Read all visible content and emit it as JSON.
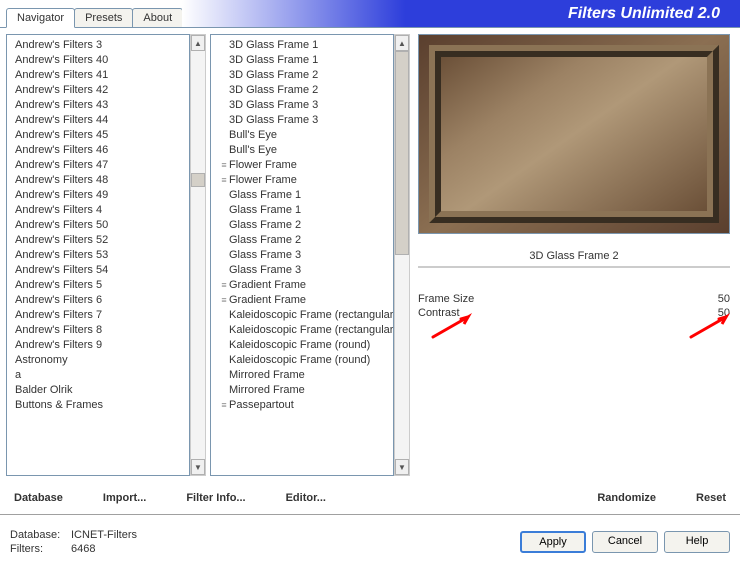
{
  "header": {
    "tabs": [
      {
        "label": "Navigator",
        "active": true
      },
      {
        "label": "Presets",
        "active": false
      },
      {
        "label": "About",
        "active": false
      }
    ],
    "banner_title": "Filters Unlimited 2.0"
  },
  "list_left": [
    "Andrew's Filters 3",
    "Andrew's Filters 40",
    "Andrew's Filters 41",
    "Andrew's Filters 42",
    "Andrew's Filters 43",
    "Andrew's Filters 44",
    "Andrew's Filters 45",
    "Andrew's Filters 46",
    "Andrew's Filters 47",
    "Andrew's Filters 48",
    "Andrew's Filters 49",
    "Andrew's Filters 4",
    "Andrew's Filters 50",
    "Andrew's Filters 52",
    "Andrew's Filters 53",
    "Andrew's Filters 54",
    "Andrew's Filters 5",
    "Andrew's Filters 6",
    "Andrew's Filters 7",
    "Andrew's Filters 8",
    "Andrew's Filters 9",
    "Astronomy",
    "a",
    "Balder Olrik",
    "Buttons & Frames"
  ],
  "list_right": [
    {
      "label": "3D Glass Frame 1",
      "decor": ""
    },
    {
      "label": "3D Glass Frame 1",
      "decor": ""
    },
    {
      "label": "3D Glass Frame 2",
      "decor": ""
    },
    {
      "label": "3D Glass Frame 2",
      "decor": ""
    },
    {
      "label": "3D Glass Frame 3",
      "decor": ""
    },
    {
      "label": "3D Glass Frame 3",
      "decor": ""
    },
    {
      "label": "Bull's Eye",
      "decor": ""
    },
    {
      "label": "Bull's Eye",
      "decor": ""
    },
    {
      "label": "Flower Frame",
      "decor": "≡"
    },
    {
      "label": "Flower Frame",
      "decor": "≡"
    },
    {
      "label": "Glass Frame 1",
      "decor": ""
    },
    {
      "label": "Glass Frame 1",
      "decor": ""
    },
    {
      "label": "Glass Frame 2",
      "decor": ""
    },
    {
      "label": "Glass Frame 2",
      "decor": ""
    },
    {
      "label": "Glass Frame 3",
      "decor": ""
    },
    {
      "label": "Glass Frame 3",
      "decor": ""
    },
    {
      "label": "Gradient Frame",
      "decor": "≡"
    },
    {
      "label": "Gradient Frame",
      "decor": "≡"
    },
    {
      "label": "Kaleidoscopic Frame (rectangular)",
      "decor": ""
    },
    {
      "label": "Kaleidoscopic Frame (rectangular)",
      "decor": ""
    },
    {
      "label": "Kaleidoscopic Frame (round)",
      "decor": ""
    },
    {
      "label": "Kaleidoscopic Frame (round)",
      "decor": ""
    },
    {
      "label": "Mirrored Frame",
      "decor": ""
    },
    {
      "label": "Mirrored Frame",
      "decor": ""
    },
    {
      "label": "Passepartout",
      "decor": "≡"
    }
  ],
  "preview": {
    "caption": "3D Glass Frame 2"
  },
  "params": [
    {
      "label": "Frame Size",
      "value": "50"
    },
    {
      "label": "Contrast",
      "value": "50"
    }
  ],
  "toolbar": {
    "database": "Database",
    "import": "Import...",
    "filter_info": "Filter Info...",
    "editor": "Editor...",
    "randomize": "Randomize",
    "reset": "Reset"
  },
  "footer": {
    "db_label": "Database:",
    "db_value": "ICNET-Filters",
    "filters_label": "Filters:",
    "filters_value": "6468",
    "apply": "Apply",
    "cancel": "Cancel",
    "help": "Help"
  }
}
